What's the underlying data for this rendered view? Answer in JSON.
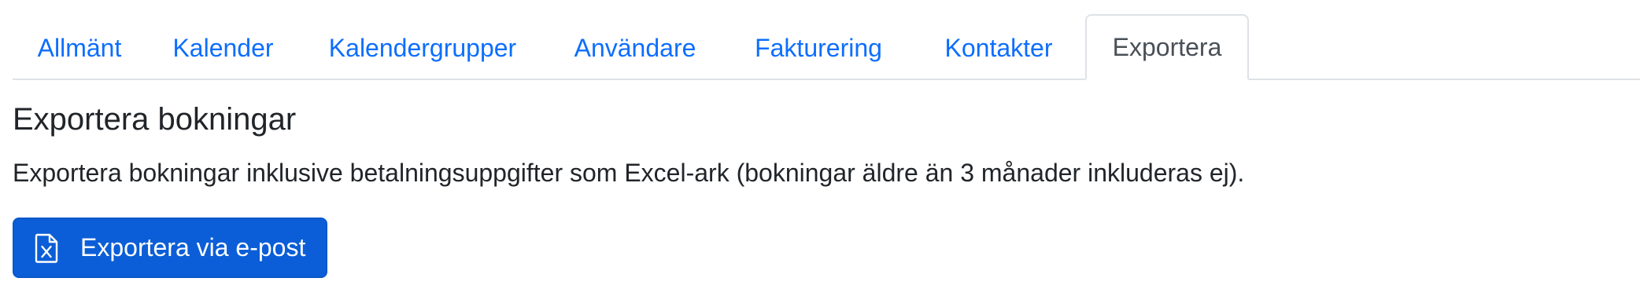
{
  "tabs": [
    {
      "label": "Allmänt",
      "active": false
    },
    {
      "label": "Kalender",
      "active": false
    },
    {
      "label": "Kalendergrupper",
      "active": false
    },
    {
      "label": "Användare",
      "active": false
    },
    {
      "label": "Fakturering",
      "active": false
    },
    {
      "label": "Kontakter",
      "active": false
    },
    {
      "label": "Exportera",
      "active": true
    }
  ],
  "section": {
    "title": "Exportera bokningar",
    "description": "Exportera bokningar inklusive betalningsuppgifter som Excel-ark (bokningar äldre än 3 månader inkluderas ej)."
  },
  "export_button": {
    "label": "Exportera via e-post",
    "icon": "file-excel-icon"
  },
  "colors": {
    "link": "#0d6efd",
    "primary_button": "#0b5ed7",
    "active_tab_text": "#495057"
  }
}
